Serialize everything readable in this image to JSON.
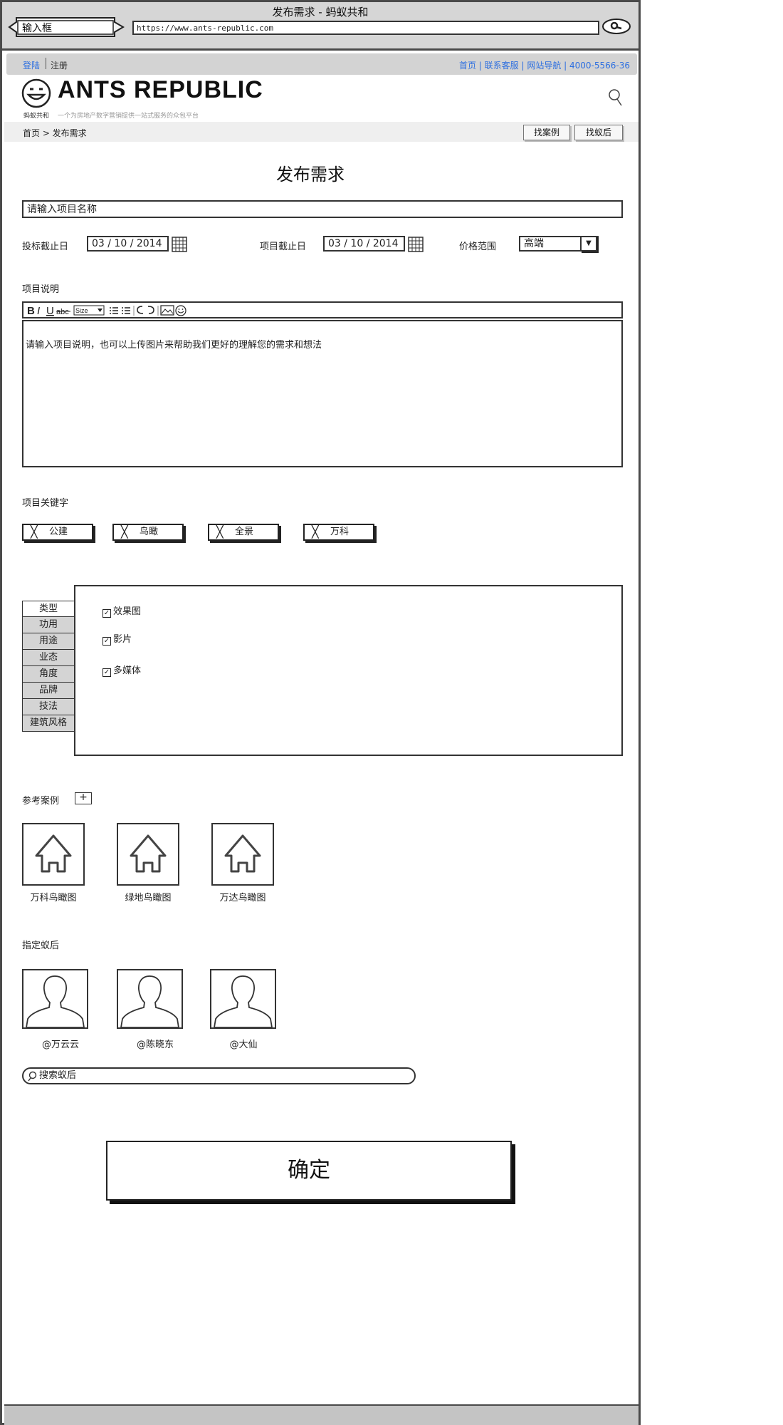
{
  "window": {
    "title": "发布需求 - 蚂蚁共和",
    "tab_label": "输入框",
    "url": "https://www.ants-republic.com"
  },
  "topbar": {
    "login": "登陆",
    "register": "注册",
    "links": "首页 | 联系客服 | 网站导航 | 4000-5566-36"
  },
  "brand": {
    "name": "ANTS REPUBLIC",
    "subtitle": "蚂蚁共和",
    "tagline": "一个为房地产数字营销提供一站式服务的众包平台"
  },
  "breadcrumb": "首页 > 发布需求",
  "header_buttons": {
    "find_case": "找案例",
    "find_queen": "找蚁后"
  },
  "page_title": "发布需求",
  "project_name": {
    "placeholder": "请输入项目名称"
  },
  "dates": {
    "bid_deadline_label": "投标截止日",
    "bid_deadline_value": "03 / 10 / 2014",
    "project_deadline_label": "项目截止日",
    "project_deadline_value": "03 / 10 / 2014"
  },
  "price": {
    "label": "价格范围",
    "value": "高端"
  },
  "description": {
    "label": "项目说明",
    "placeholder": "请输入项目说明，也可以上传图片来帮助我们更好的理解您的需求和想法",
    "font_size_label": "Size"
  },
  "keywords": {
    "label": "项目关键字",
    "items": [
      "公建",
      "鸟瞰",
      "全景",
      "万科"
    ]
  },
  "category_tabs": [
    "类型",
    "功用",
    "用途",
    "业态",
    "角度",
    "品牌",
    "技法",
    "建筑风格"
  ],
  "type_options": [
    {
      "label": "效果图",
      "checked": true
    },
    {
      "label": "影片",
      "checked": true
    },
    {
      "label": "多媒体",
      "checked": true
    }
  ],
  "reference_cases": {
    "label": "参考案例",
    "add_symbol": "+",
    "items": [
      "万科鸟瞰图",
      "绿地鸟瞰图",
      "万达鸟瞰图"
    ]
  },
  "designated_queen": {
    "label": "指定蚁后",
    "people": [
      "@万云云",
      "@陈晓东",
      "@大仙"
    ],
    "search_placeholder": "搜索蚁后"
  },
  "confirm_label": "确定"
}
